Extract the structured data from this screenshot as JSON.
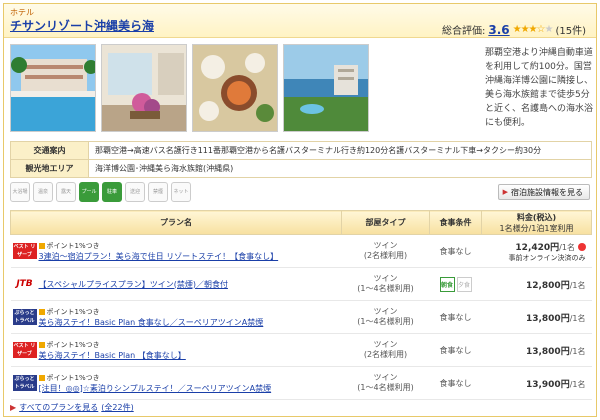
{
  "hotel": {
    "category": "ホテル",
    "name": "チサンリゾート沖縄美ら海",
    "rating_label": "総合評価:",
    "rating_score": "3.6",
    "rating_stars": 3.5,
    "review_count": "(15件)",
    "description": "那覇空港より沖縄自動車道を利用して約100分。国営沖縄海洋博公園に隣接し、美ら海水族館まで徒歩5分と近く、名護島への海水浴にも便利。"
  },
  "photos": [
    {
      "name": "pool-photo"
    },
    {
      "name": "lobby-photo"
    },
    {
      "name": "meal-photo"
    },
    {
      "name": "coast-photo"
    }
  ],
  "info": {
    "access_label": "交通案内",
    "access_value": "那覇空港→高速バス名護行き111番那覇空港から名護バスターミナル行き約120分名護バスターミナル下車→タクシー約30分",
    "sight_label": "観光地エリア",
    "sight_value": "海洋博公園･沖縄美ら海水族館(沖縄県)"
  },
  "amenities": [
    {
      "label": "大浴場",
      "on": false
    },
    {
      "label": "温泉",
      "on": false
    },
    {
      "label": "露天",
      "on": false
    },
    {
      "label": "プール",
      "on": true
    },
    {
      "label": "駐車",
      "on": true
    },
    {
      "label": "送迎",
      "on": false
    },
    {
      "label": "禁煙",
      "on": false
    },
    {
      "label": "ネット",
      "on": false
    }
  ],
  "detail_button": "宿泊施設情報を見る",
  "plans_header": {
    "plan": "プラン名",
    "room": "部屋タイプ",
    "meal": "食事条件",
    "price": "料金(税込)",
    "price_sub": "1名様分/1泊1室利用"
  },
  "plans": [
    {
      "logo": "ベスト リザーブ",
      "logo_style": "red",
      "points": "ポイント1%つき",
      "name": "3連泊～宿泊プラン！美ら海で住日 リゾートステイ！【食事なし】",
      "room": "ツイン",
      "room_sub": "(2名様利用)",
      "meal": "食事なし",
      "price": "12,420円",
      "price_unit": "/1名",
      "extra": "事前オンライン決済のみ",
      "coin": true
    },
    {
      "logo": "JTB",
      "logo_style": "jtb",
      "points": "",
      "name": "【スペシャルプライスプラン】ツイン(禁煙)／朝食付",
      "room": "ツイン",
      "room_sub": "(1～4名様利用)",
      "meal": "",
      "meal_icons": [
        "朝食",
        "夕食"
      ],
      "price": "12,800円",
      "price_unit": "/1名",
      "extra": "",
      "coin": false
    },
    {
      "logo": "ぷらっと トラベル",
      "logo_style": "blue",
      "points": "ポイント1%つき",
      "name": "美ら海ステイ！Basic Plan 食事なし／スーペリアツインA禁煙",
      "room": "ツイン",
      "room_sub": "(1～4名様利用)",
      "meal": "食事なし",
      "price": "13,800円",
      "price_unit": "/1名",
      "extra": "",
      "coin": false
    },
    {
      "logo": "ベスト リザーブ",
      "logo_style": "red",
      "points": "ポイント1%つき",
      "name": "美ら海ステイ！Basic Plan 【食事なし】",
      "room": "ツイン",
      "room_sub": "(2名様利用)",
      "meal": "食事なし",
      "price": "13,800円",
      "price_unit": "/1名",
      "extra": "",
      "coin": false
    },
    {
      "logo": "ぷらっと トラベル",
      "logo_style": "blue",
      "points": "ポイント1%つき",
      "name": "[注目！◎◎]☆素泊りシンプルステイ！／スーペリアツインA禁煙",
      "room": "ツイン",
      "room_sub": "(1～4名様利用)",
      "meal": "食事なし",
      "price": "13,900円",
      "price_unit": "/1名",
      "extra": "",
      "coin": false
    }
  ],
  "all_plans_link": "すべてのプランを見る",
  "all_plans_count": "(全22件)",
  "colors": {
    "accent": "#1a3fa8",
    "header_bg": "#fff3c4",
    "border": "#e8c96a"
  }
}
